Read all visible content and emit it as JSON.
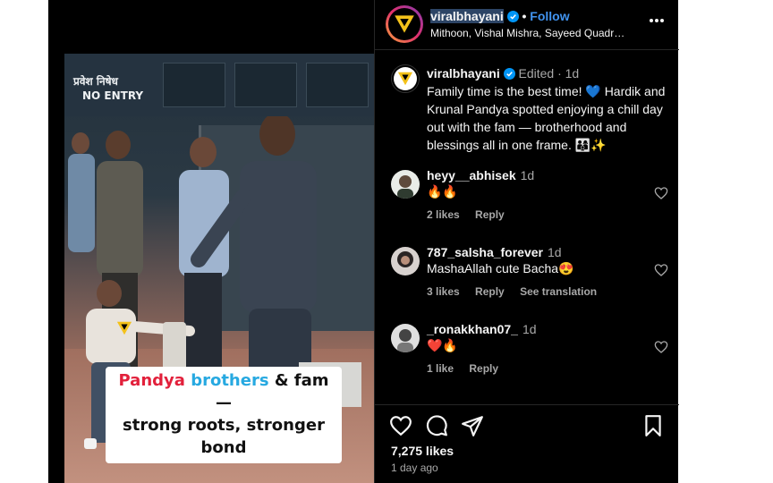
{
  "header": {
    "username": "viralbhayani",
    "follow_label": "Follow",
    "subtitle": "Mithoon, Vishal Mishra, Sayeed Quadr…",
    "more_icon": "more-horizontal-icon"
  },
  "video": {
    "sign_hindi": "प्रवेश  निषेध",
    "sign_english": "NO   ENTRY",
    "caption_line1_a": "Pandya",
    "caption_line1_b": "brothers",
    "caption_line1_c": "& fam —",
    "caption_line2": "strong roots, stronger bond"
  },
  "post": {
    "username": "viralbhayani",
    "edited_label": "Edited",
    "time": "1d",
    "caption": "Family time is the best time! 💙 Hardik and Krunal Pandya spotted enjoying a chill day out with the fam — brotherhood and blessings all in one frame. 👨‍👩‍👦✨"
  },
  "comments": [
    {
      "user": "heyy__abhisek",
      "time": "1d",
      "text": "🔥🔥",
      "likes": "2 likes",
      "reply": "Reply",
      "translate": ""
    },
    {
      "user": "787_salsha_forever",
      "time": "1d",
      "text": "MashaAllah cute Bacha😍",
      "likes": "3 likes",
      "reply": "Reply",
      "translate": "See translation"
    },
    {
      "user": "_ronakkhan07_",
      "time": "1d",
      "text": "❤️🔥",
      "likes": "1 like",
      "reply": "Reply",
      "translate": ""
    }
  ],
  "footer": {
    "likes": "7,275 likes",
    "time_ago": "1 day ago"
  },
  "colors": {
    "background": "#000000",
    "link_blue": "#4193ef",
    "verified_blue": "#0095f6",
    "caption_red": "#e2203b",
    "caption_blue": "#27a9e1"
  }
}
